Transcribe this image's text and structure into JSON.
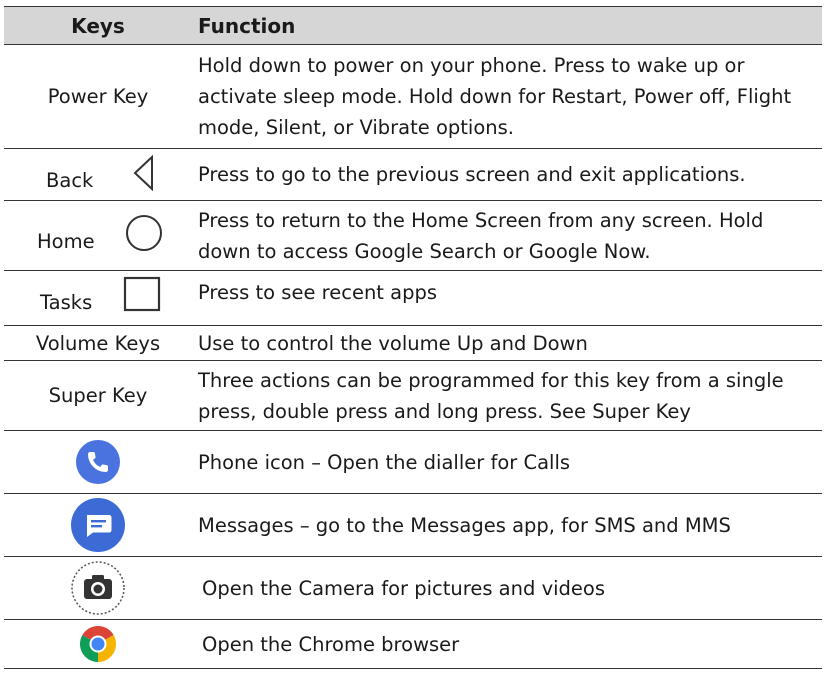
{
  "header": {
    "keys": "Keys",
    "function": "Function"
  },
  "rows": [
    {
      "key": "Power Key",
      "function": "Hold down to power on your phone. Press to wake up or activate sleep mode. Hold down for Restart, Power off, Flight mode, Silent, or Vibrate options."
    },
    {
      "key": "Back",
      "icon": "back-triangle-icon",
      "function": "Press to go to the previous screen and exit applications."
    },
    {
      "key": "Home",
      "icon": "home-circle-icon",
      "function": "Press to return to the Home Screen from any screen. Hold down to access Google Search or Google Now."
    },
    {
      "key": "Tasks",
      "icon": "tasks-square-icon",
      "function": "Press to see recent apps"
    },
    {
      "key": "Volume Keys",
      "function": "Use to control the volume Up and Down"
    },
    {
      "key": "Super Key",
      "function": "Three actions can be programmed for this key from a single press, double press and long press. See Super Key"
    },
    {
      "icon": "phone-app-icon",
      "function": "Phone icon – Open the dialler for Calls"
    },
    {
      "icon": "messages-app-icon",
      "function": "Messages – go to the Messages app, for SMS and MMS"
    },
    {
      "icon": "camera-app-icon",
      "function": "Open the Camera for pictures and videos"
    },
    {
      "icon": "chrome-app-icon",
      "function": "Open the Chrome browser"
    }
  ],
  "colors": {
    "header_bg": "#d6d6d6",
    "phone_blue": "#4a73e0",
    "messages_blue": "#3d6bd6"
  }
}
